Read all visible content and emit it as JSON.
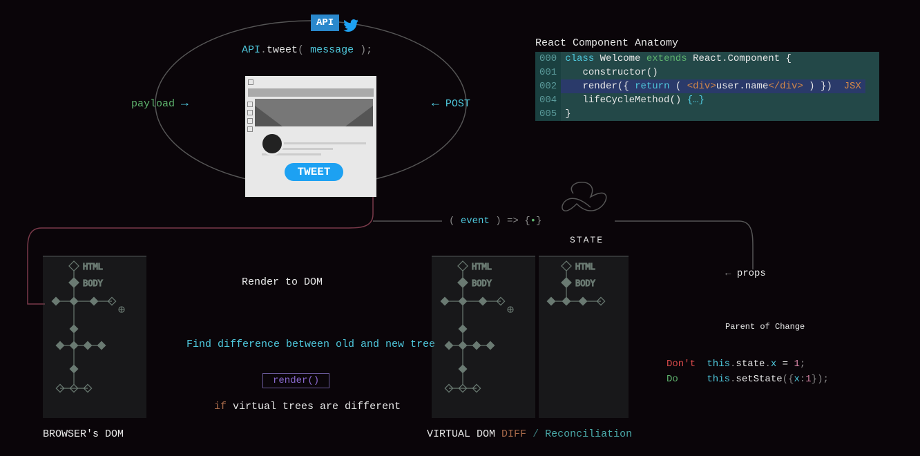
{
  "api": {
    "badge": "API",
    "call_prefix": "API",
    "call_dot": ".",
    "call_method": "tweet",
    "call_open": "( ",
    "call_arg": "message",
    "call_close": " );"
  },
  "labels": {
    "payload": "payload",
    "post": "POST",
    "event_open": "( ",
    "event_name": "event",
    "event_close": " ) => {",
    "event_dot": "•",
    "event_end": "}",
    "state": "STATE",
    "props": "props",
    "render_to_dom": "Render to DOM",
    "diff_desc": "Find difference between old and new tree",
    "render_call": "render()",
    "if": "if",
    "if_cond": "virtual trees are different",
    "browser_dom": "BROWSER's DOM",
    "virtual_dom": "VIRTUAL DOM",
    "diff": "DIFF",
    "slash": "/",
    "reconciliation": "Reconciliation",
    "parent_change": "Parent of Change"
  },
  "tweet_button": "TWEET",
  "anatomy": {
    "title": "React Component Anatomy",
    "gutter": [
      "000",
      "001",
      "002",
      "004",
      "005"
    ],
    "line0": {
      "kw_class": "class ",
      "name": "Welcome ",
      "kw_extends": "extends ",
      "base": "React.Component {"
    },
    "line1": {
      "method": "constructor",
      "parens": "()"
    },
    "line2": {
      "method": "render",
      "open": "({ ",
      "ret": "return",
      "paren_open": " ( ",
      "tag_open": "<div>",
      "content": "user.name",
      "tag_close": "</div>",
      "paren_close": " )",
      "close": " })",
      "annot": "JSX"
    },
    "line3": {
      "method": "lifeCycleMethod",
      "parens": "() ",
      "body": "{…}"
    },
    "line4": {
      "brace": "}"
    }
  },
  "dom_tree": {
    "html": "HTML",
    "body": "BODY"
  },
  "state_rules": {
    "dont": "Don't",
    "do": "Do",
    "bad_prefix": "this",
    "bad_dot1": ".",
    "bad_state": "state",
    "bad_dot2": ".",
    "bad_x": "x",
    "bad_assign": " = ",
    "bad_val": "1",
    "bad_semi": ";",
    "good_prefix": "this",
    "good_dot": ".",
    "good_method": "setState",
    "good_open": "({",
    "good_key": "x",
    "good_colon": ":",
    "good_val": "1",
    "good_close": "});"
  }
}
